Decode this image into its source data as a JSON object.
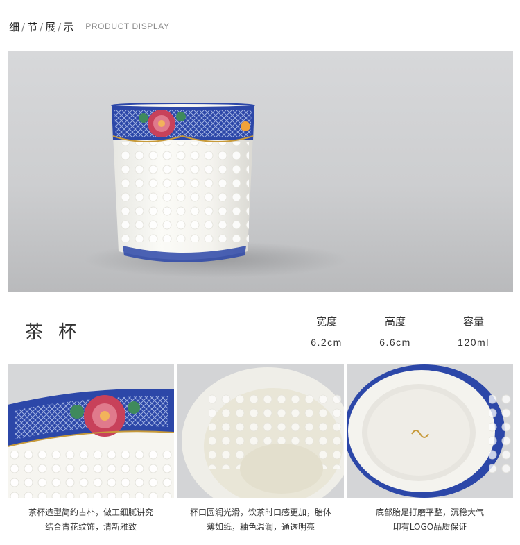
{
  "header": {
    "title_parts": [
      "细",
      "节",
      "展",
      "示"
    ],
    "title_separator": "/",
    "subtitle": "PRODUCT DISPLAY"
  },
  "hero": {
    "image": "teacup-hero-photo"
  },
  "product": {
    "name": "茶杯",
    "specs": [
      {
        "label": "宽度",
        "value": "6.2cm"
      },
      {
        "label": "高度",
        "value": "6.6cm"
      },
      {
        "label": "容量",
        "value": "120ml"
      }
    ]
  },
  "details": [
    {
      "image": "rim-closeup-photo",
      "caption_line1": "茶杯造型简约古朴，做工细腻讲究",
      "caption_line2": "结合青花纹饰，清新雅致"
    },
    {
      "image": "interior-photo",
      "caption_line1": "杯口圆润光滑，饮茶时口感更加，胎体",
      "caption_line2": "薄如纸，釉色温润，通透明亮"
    },
    {
      "image": "base-photo",
      "caption_line1": "底部胎足打磨平整，沉稳大气",
      "caption_line2": "印有LOGO品质保证"
    }
  ],
  "colors": {
    "cobalt": "#2c47a8",
    "peony": "#c8415a",
    "gold": "#c79a3a",
    "porcelain": "#f4f3ee"
  }
}
